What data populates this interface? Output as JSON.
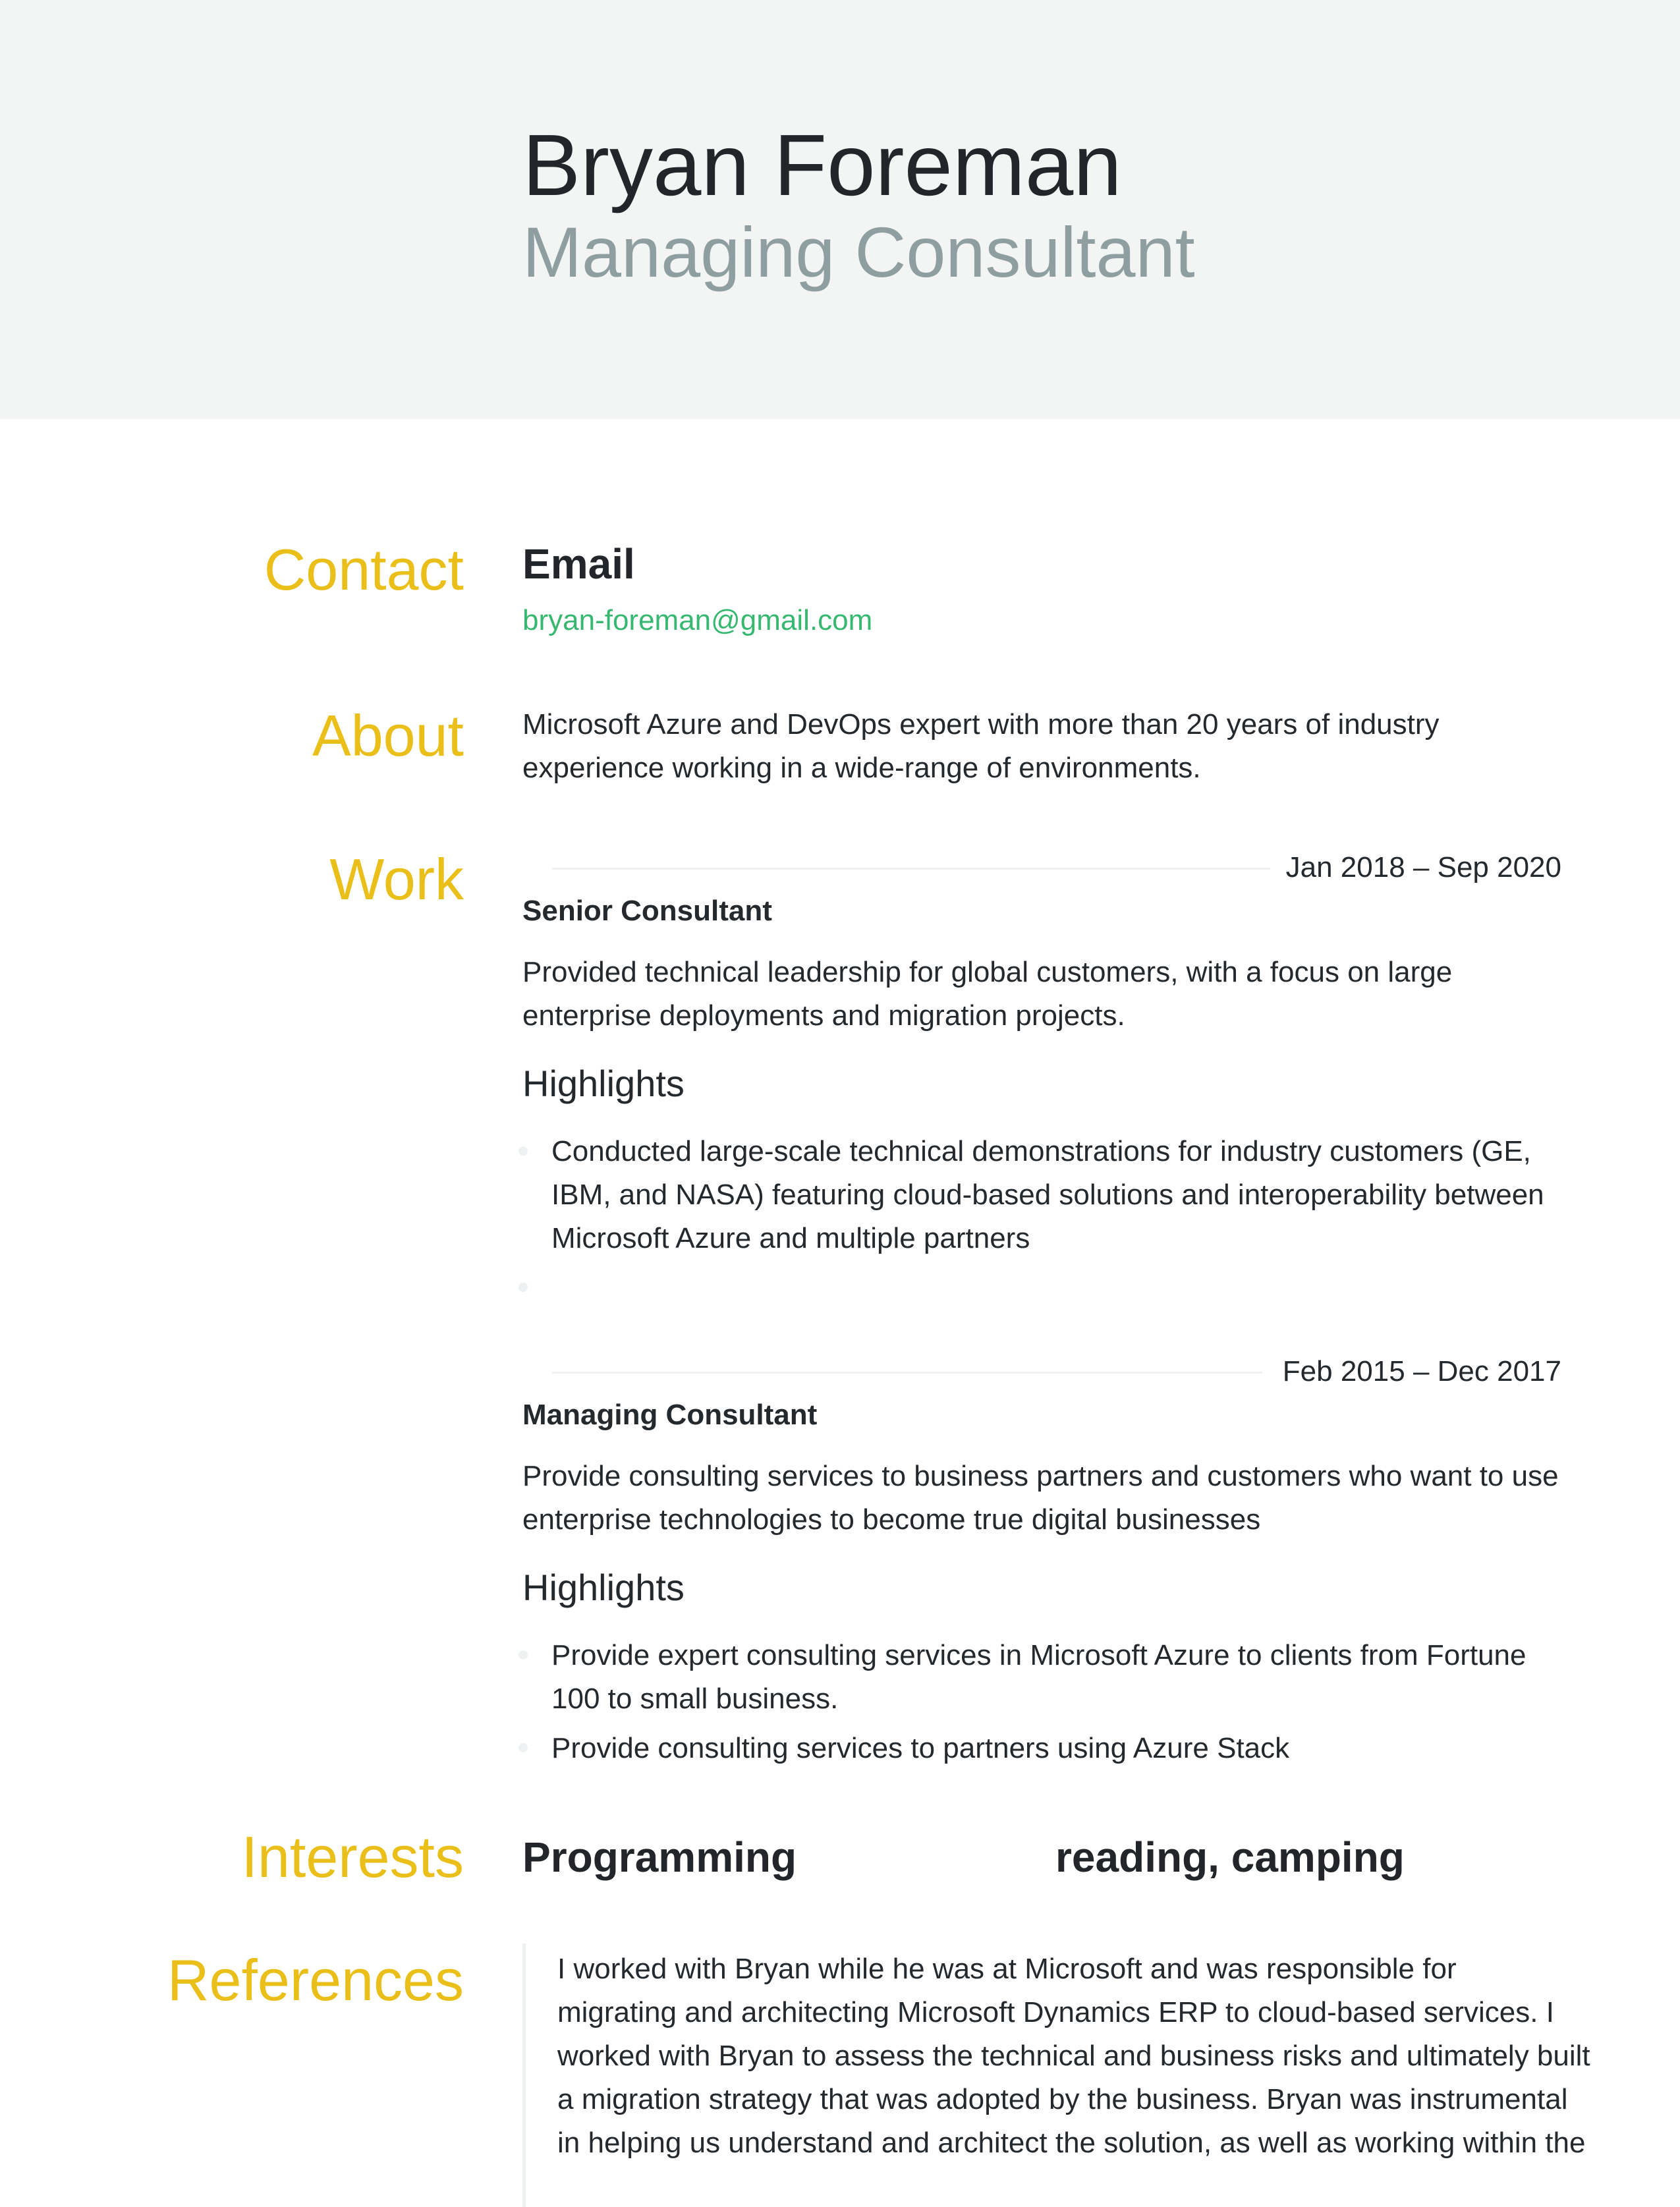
{
  "header": {
    "name": "Bryan Foreman",
    "title": "Managing Consultant"
  },
  "sections": {
    "contact": "Contact",
    "about": "About",
    "work": "Work",
    "interests": "Interests",
    "references": "References"
  },
  "contact": {
    "email_label": "Email",
    "email": "bryan-foreman@gmail.com"
  },
  "about": {
    "lines": [
      "Microsoft Azure and DevOps expert with more than 20 years of industry",
      "experience working in a wide-range of environments."
    ]
  },
  "work": [
    {
      "date": "Jan 2018 – Sep 2020",
      "position": "Senior Consultant",
      "summary_lines": [
        "Provided technical leadership for global customers, with a focus on large",
        "enterprise deployments and migration projects."
      ],
      "highlights_label": "Highlights",
      "highlights": [
        [
          "Conducted large-scale technical demonstrations for industry customers (GE,",
          "IBM, and NASA) featuring cloud-based solutions and interoperability between",
          "Microsoft Azure and multiple partners"
        ],
        []
      ]
    },
    {
      "date": "Feb 2015 – Dec 2017",
      "position": "Managing Consultant",
      "summary_lines": [
        "Provide consulting services to business partners and customers who want to use",
        "enterprise technologies to become true digital businesses"
      ],
      "highlights_label": "Highlights",
      "highlights": [
        [
          "Provide expert consulting services in Microsoft Azure to clients from Fortune",
          "100 to small business."
        ],
        [
          "Provide consulting services to partners using Azure Stack"
        ]
      ]
    }
  ],
  "interests": [
    "Programming",
    "reading, camping"
  ],
  "references": {
    "lines": [
      "I worked with Bryan while he was at Microsoft and was responsible for",
      "migrating and architecting Microsoft Dynamics ERP to cloud-based services. I",
      "worked with Bryan to assess the technical and business risks and ultimately built",
      "a migration strategy that was adopted by the business. Bryan was instrumental",
      "in helping us understand and architect the solution, as well as working within the"
    ]
  }
}
